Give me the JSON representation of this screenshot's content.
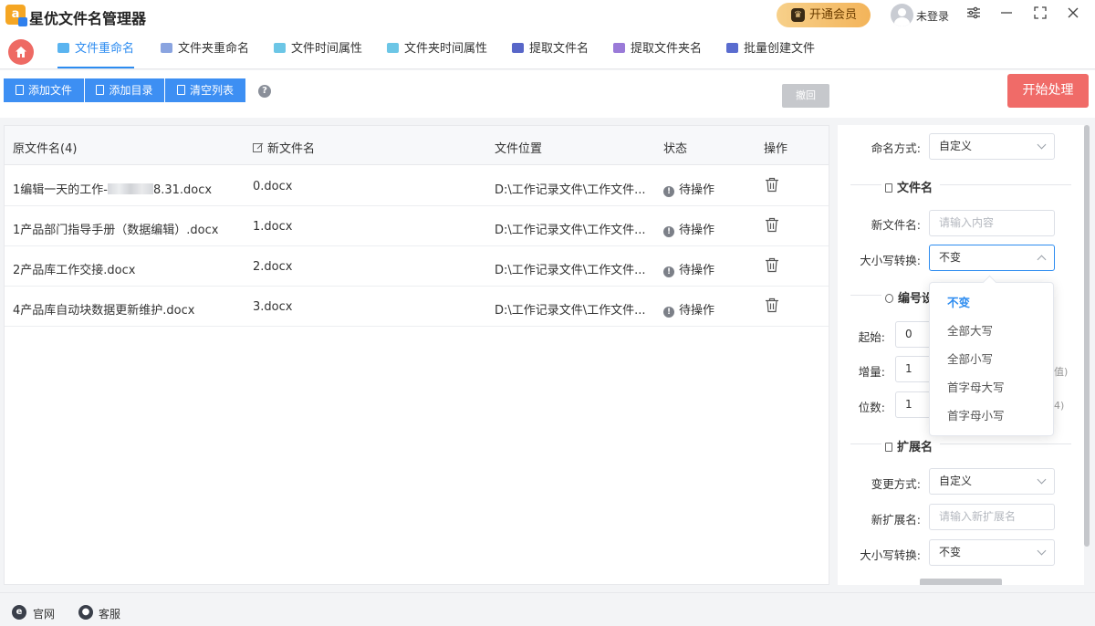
{
  "app": {
    "title": "星优文件名管理器"
  },
  "titlebar": {
    "vip_label": "开通会员",
    "login_label": "未登录",
    "icons": [
      "settings-icon",
      "minimize-icon",
      "maximize-icon",
      "close-icon"
    ]
  },
  "tabs": [
    {
      "label": "文件重命名",
      "active": true,
      "color": "#2d8cf0"
    },
    {
      "label": "文件夹重命名",
      "color": "#5b7fd4"
    },
    {
      "label": "文件时间属性",
      "color": "#35a8d8"
    },
    {
      "label": "文件夹时间属性",
      "color": "#35a8d8"
    },
    {
      "label": "提取文件名",
      "color": "#5866c8"
    },
    {
      "label": "提取文件夹名",
      "color": "#7a5cc8"
    },
    {
      "label": "批量创建文件",
      "color": "#4f63c9"
    }
  ],
  "toolbar": {
    "add_file": "添加文件",
    "add_dir": "添加目录",
    "clear_list": "清空列表",
    "undo": "撤回",
    "start": "开始处理",
    "help": "?"
  },
  "table": {
    "headers": {
      "orig": "原文件名(4)",
      "new": "新文件名",
      "loc": "文件位置",
      "status": "状态",
      "op": "操作"
    },
    "rows": [
      {
        "orig_prefix": "1编辑一天的工作-",
        "orig_suffix": "8.31.docx",
        "new": "0.docx",
        "loc": "D:\\工作记录文件\\工作文件...",
        "status": "待操作"
      },
      {
        "orig": "1产品部门指导手册（数据编辑）.docx",
        "new": "1.docx",
        "loc": "D:\\工作记录文件\\工作文件...",
        "status": "待操作"
      },
      {
        "orig": "2产品库工作交接.docx",
        "new": "2.docx",
        "loc": "D:\\工作记录文件\\工作文件...",
        "status": "待操作"
      },
      {
        "orig": "4产品库自动块数据更新维护.docx",
        "new": "3.docx",
        "loc": "D:\\工作记录文件\\工作文件...",
        "status": "待操作"
      }
    ]
  },
  "settings": {
    "naming_mode_label": "命名方式:",
    "naming_mode_value": "自定义",
    "filename_section": "文件名",
    "new_name_label": "新文件名:",
    "new_name_placeholder": "请输入内容",
    "case_label": "大小写转换:",
    "case_value": "不变",
    "number_section": "编号设",
    "start_label": "起始:",
    "start_value": "0",
    "step_label": "增量:",
    "step_value": "1",
    "step_hint": "值)",
    "digits_label": "位数:",
    "digits_value": "1",
    "digits_hint": "4)",
    "ext_section": "扩展名",
    "ext_mode_label": "变更方式:",
    "ext_mode_value": "自定义",
    "new_ext_label": "新扩展名:",
    "new_ext_placeholder": "请输入新扩展名",
    "ext_case_label": "大小写转换:",
    "ext_case_value": "不变"
  },
  "dropdown": {
    "options": [
      "不变",
      "全部大写",
      "全部小写",
      "首字母大写",
      "首字母小写"
    ],
    "selected": "不变"
  },
  "footer": {
    "website": "官网",
    "service": "客服"
  },
  "colors": {
    "accent": "#2d8cf0",
    "button_blue": "#3d8ff3",
    "start_red": "#f06b68",
    "home_red": "#ee6a64",
    "vip_gold": "#f3b45a"
  }
}
